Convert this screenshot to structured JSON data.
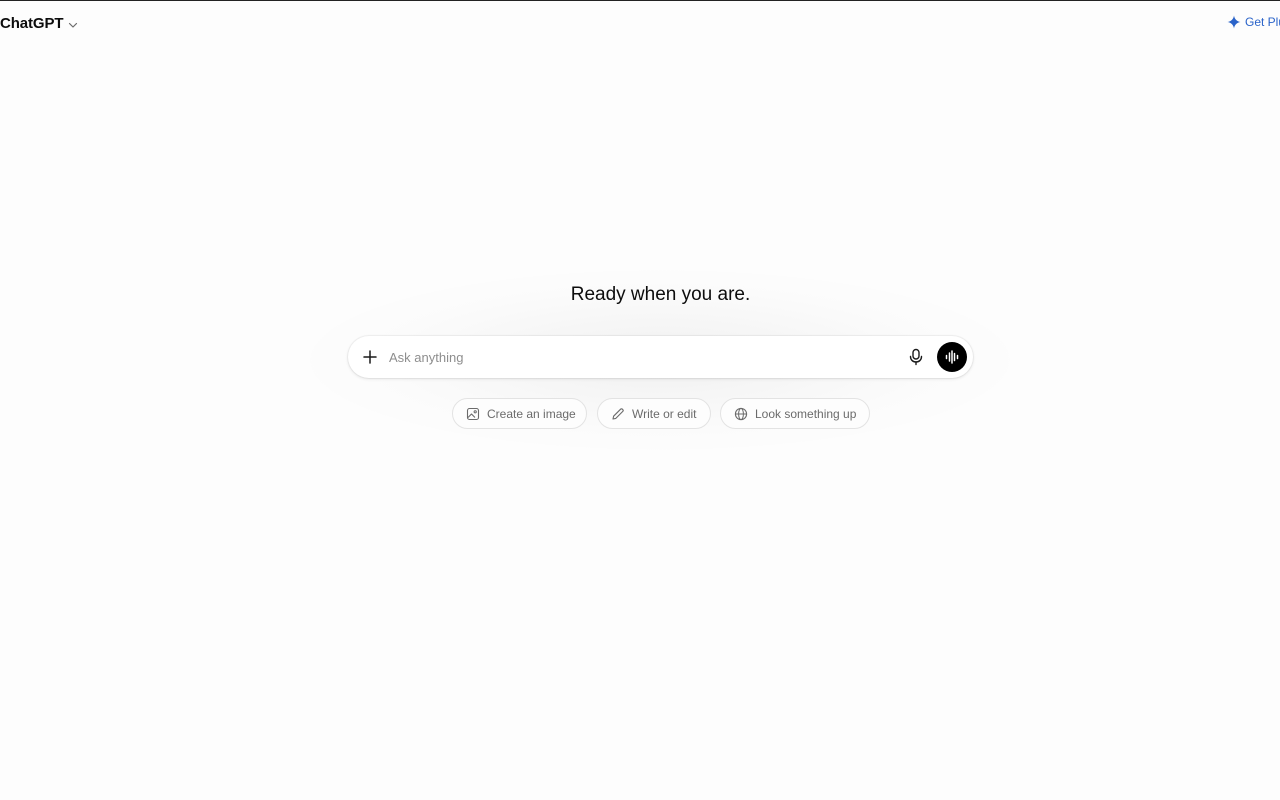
{
  "header": {
    "model_name": "ChatGPT",
    "upgrade_label": "Get Plu",
    "accent_color": "#2a63c9"
  },
  "main": {
    "headline": "Ready when you are.",
    "composer": {
      "placeholder": "Ask anything",
      "value": "",
      "icons": [
        "plus-icon",
        "microphone-icon",
        "voice-waveform-icon"
      ]
    },
    "suggestions": [
      {
        "label": "Create an image",
        "icon": "image-icon"
      },
      {
        "label": "Write or edit",
        "icon": "pencil-icon"
      },
      {
        "label": "Look something up",
        "icon": "globe-icon"
      }
    ]
  }
}
